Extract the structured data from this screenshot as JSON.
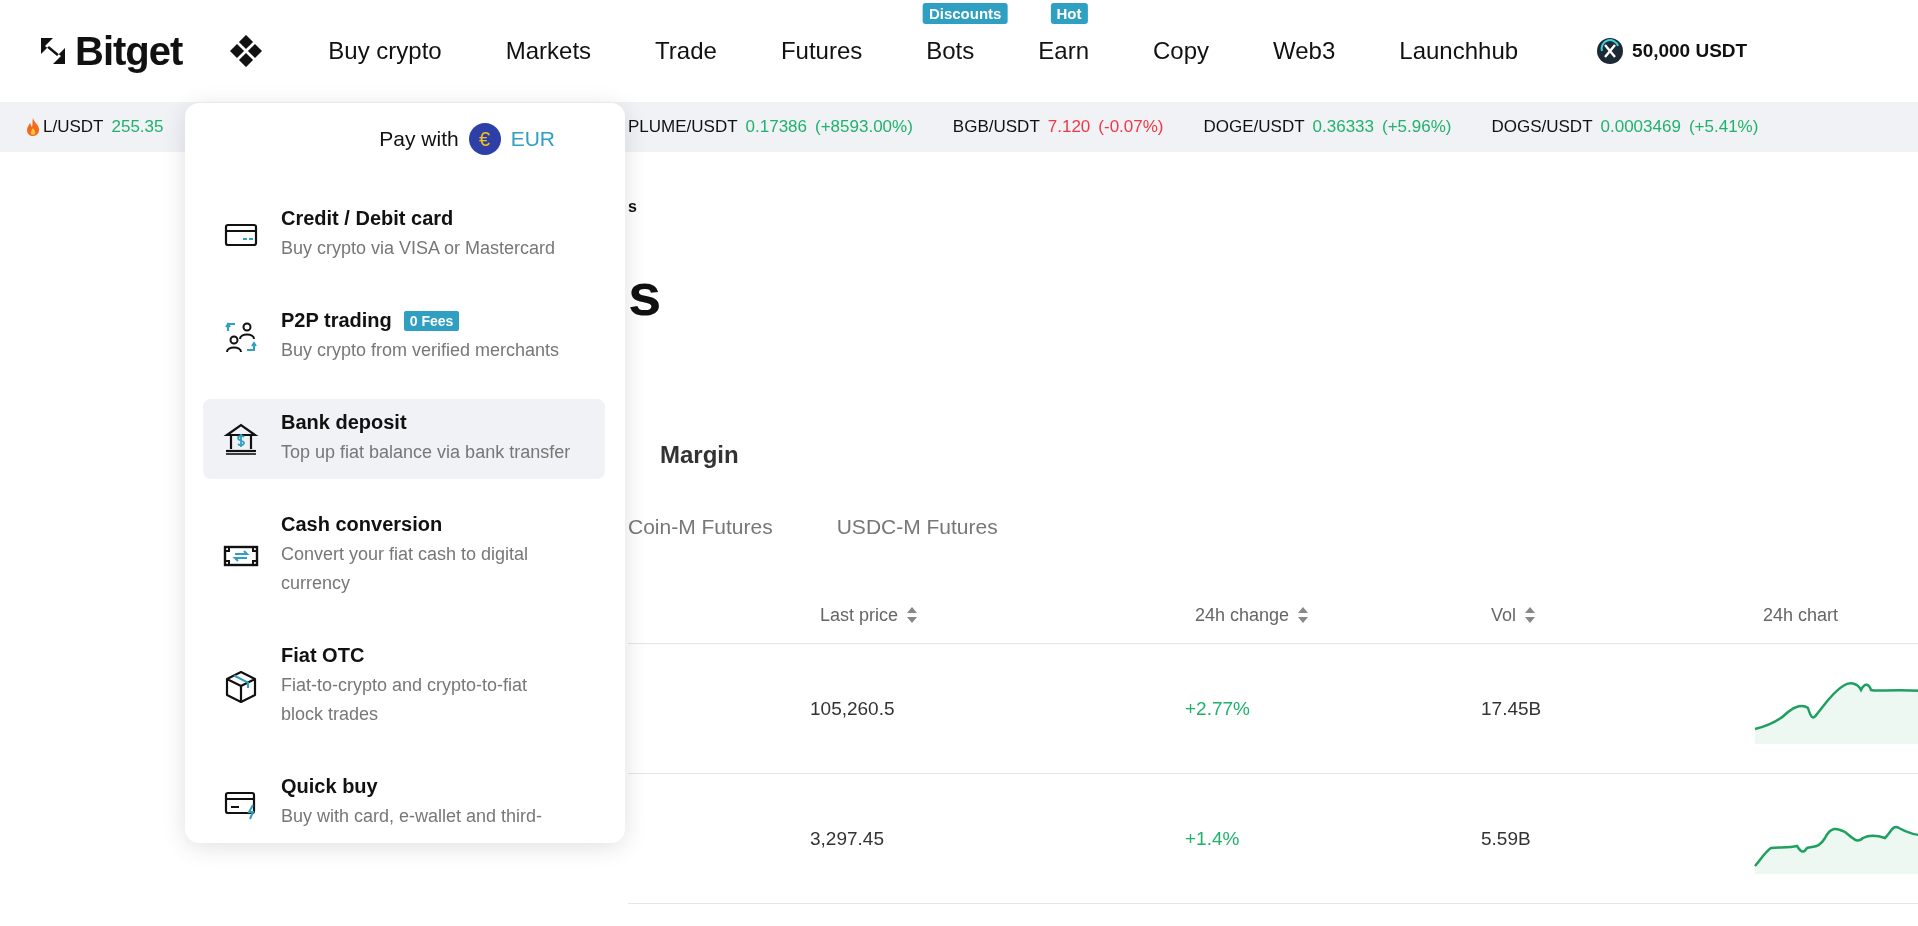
{
  "header": {
    "logo": "Bitget",
    "nav": [
      {
        "label": "Buy crypto"
      },
      {
        "label": "Markets"
      },
      {
        "label": "Trade"
      },
      {
        "label": "Futures"
      },
      {
        "label": "Bots",
        "badge": "Discounts"
      },
      {
        "label": "Earn",
        "badge": "Hot"
      },
      {
        "label": "Copy"
      },
      {
        "label": "Web3"
      },
      {
        "label": "Launchhub"
      }
    ],
    "promo": "50,000 USDT"
  },
  "ticker": [
    {
      "hot": true,
      "pair": "L/USDT",
      "price": "255.35",
      "rising": true
    },
    {
      "hot": false,
      "pair": "PLUME/USDT",
      "price": "0.17386",
      "change": "(+8593.00%)",
      "rising": true
    },
    {
      "hot": false,
      "pair": "BGB/USDT",
      "price": "7.120",
      "change": "(-0.07%)",
      "rising": false
    },
    {
      "hot": false,
      "pair": "DOGE/USDT",
      "price": "0.36333",
      "change": "(+5.96%)",
      "rising": true
    },
    {
      "hot": false,
      "pair": "DOGS/USDT",
      "price": "0.0003469",
      "change": "(+5.41%)",
      "rising": true
    }
  ],
  "dropdown": {
    "pay_with": "Pay with",
    "currency_symbol": "€",
    "currency": "EUR",
    "items": [
      {
        "kind": "card",
        "title": "Credit / Debit card",
        "description": "Buy crypto via VISA or Mastercard",
        "highlighted": false
      },
      {
        "kind": "p2p",
        "title": "P2P trading",
        "badge": "0 Fees",
        "description": "Buy crypto from verified merchants",
        "highlighted": false
      },
      {
        "kind": "bank",
        "title": "Bank deposit",
        "description": "Top up fiat balance via bank transfer",
        "highlighted": true
      },
      {
        "kind": "cash",
        "title": "Cash conversion",
        "description": "Convert your fiat cash to digital currency",
        "highlighted": false
      },
      {
        "kind": "box",
        "title": "Fiat OTC",
        "description": "Fiat-to-crypto and crypto-to-fiat block trades",
        "highlighted": false
      },
      {
        "kind": "quick",
        "title": "Quick buy",
        "description": "Buy with card, e-wallet and third-",
        "highlighted": false
      }
    ]
  },
  "page": {
    "breadcrumb": "s",
    "title": "s",
    "tabs": [
      {
        "label": "Margin"
      }
    ],
    "subtabs": [
      {
        "label": "Coin-M Futures"
      },
      {
        "label": "USDC-M Futures"
      }
    ],
    "table": {
      "columns": [
        {
          "label": "Last price",
          "sortable": true
        },
        {
          "label": "24h change",
          "sortable": true
        },
        {
          "label": "Vol",
          "sortable": true
        },
        {
          "label": "24h chart",
          "sortable": false
        }
      ],
      "rows": [
        {
          "last_price": "105,260.5",
          "change": "+2.77%",
          "rising": true,
          "vol": "17.45B"
        },
        {
          "last_price": "3,297.45",
          "change": "+1.4%",
          "rising": true,
          "vol": "5.59B"
        }
      ]
    }
  }
}
